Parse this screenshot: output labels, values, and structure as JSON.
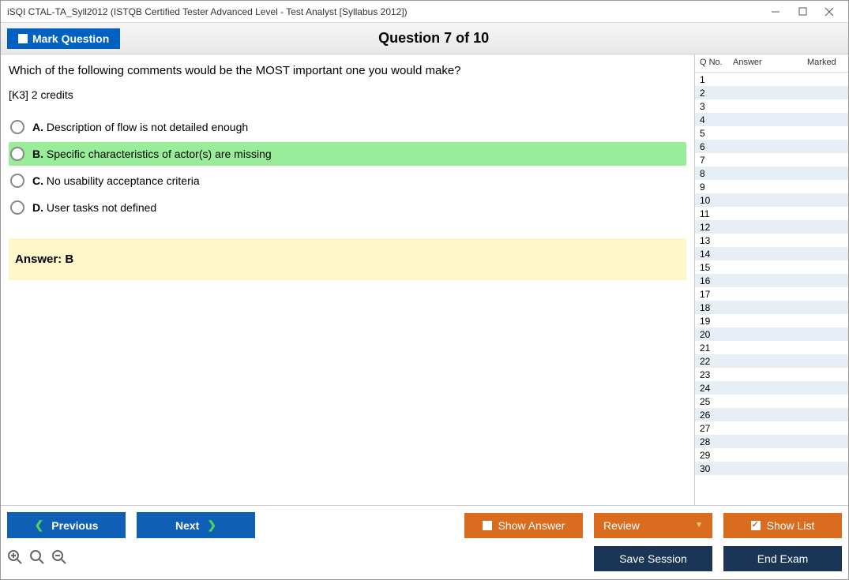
{
  "window": {
    "title": "iSQI CTAL-TA_Syll2012 (ISTQB Certified Tester Advanced Level - Test Analyst [Syllabus 2012])"
  },
  "header": {
    "mark_label": "Mark Question",
    "question_title": "Question 7 of 10"
  },
  "question": {
    "text": "Which of the following comments would be the MOST important one you would make?",
    "credits": "[K3] 2 credits",
    "options": {
      "a": {
        "letter": "A.",
        "text": "Description of flow is not detailed enough"
      },
      "b": {
        "letter": "B.",
        "text": "Specific characteristics of actor(s) are missing"
      },
      "c": {
        "letter": "C.",
        "text": "No usability acceptance criteria"
      },
      "d": {
        "letter": "D.",
        "text": "User tasks not defined"
      }
    },
    "answer_label": "Answer: B"
  },
  "side": {
    "col_qno": "Q No.",
    "col_answer": "Answer",
    "col_marked": "Marked",
    "rows": [
      "1",
      "2",
      "3",
      "4",
      "5",
      "6",
      "7",
      "8",
      "9",
      "10",
      "11",
      "12",
      "13",
      "14",
      "15",
      "16",
      "17",
      "18",
      "19",
      "20",
      "21",
      "22",
      "23",
      "24",
      "25",
      "26",
      "27",
      "28",
      "29",
      "30"
    ]
  },
  "footer": {
    "previous": "Previous",
    "next": "Next",
    "show_answer": "Show Answer",
    "review": "Review",
    "show_list": "Show List",
    "save_session": "Save Session",
    "end_exam": "End Exam"
  }
}
